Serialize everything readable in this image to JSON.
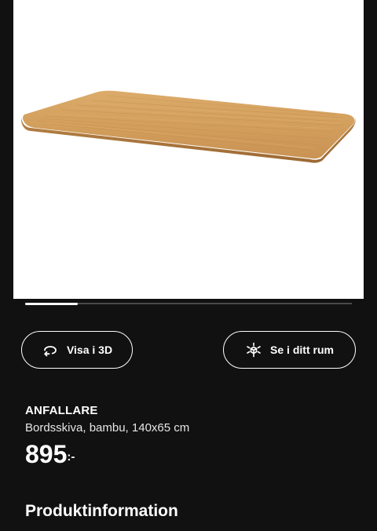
{
  "gallery": {
    "image_alt": "Tabletop in bamboo",
    "slide_progress": 0.16
  },
  "actions": {
    "view_3d_label": "Visa i 3D",
    "view_3d_icon": "rotate-3d-icon",
    "view_in_room_label": "Se i ditt rum",
    "view_in_room_icon": "ar-cube-icon"
  },
  "product": {
    "name": "ANFALLARE",
    "description": "Bordsskiva, bambu, 140x65 cm",
    "price": "895",
    "price_suffix": ":-"
  },
  "sections": {
    "product_info_title": "Produktinformation"
  },
  "colors": {
    "background": "#111111",
    "image_background": "#ffffff",
    "text": "#ffffff",
    "bamboo": "#d6a463"
  }
}
